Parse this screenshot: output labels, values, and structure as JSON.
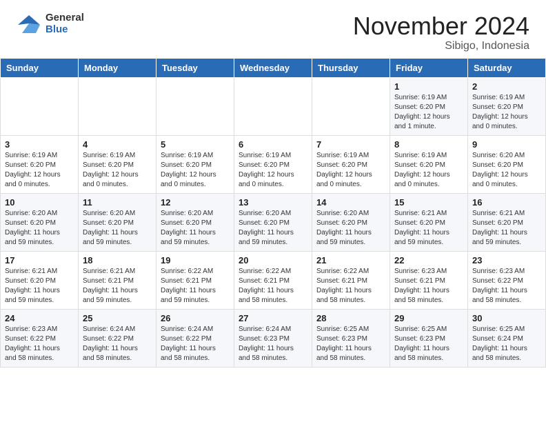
{
  "logo": {
    "general": "General",
    "blue": "Blue"
  },
  "title": {
    "month": "November 2024",
    "location": "Sibigo, Indonesia"
  },
  "weekdays": [
    "Sunday",
    "Monday",
    "Tuesday",
    "Wednesday",
    "Thursday",
    "Friday",
    "Saturday"
  ],
  "weeks": [
    [
      {
        "day": "",
        "info": ""
      },
      {
        "day": "",
        "info": ""
      },
      {
        "day": "",
        "info": ""
      },
      {
        "day": "",
        "info": ""
      },
      {
        "day": "",
        "info": ""
      },
      {
        "day": "1",
        "info": "Sunrise: 6:19 AM\nSunset: 6:20 PM\nDaylight: 12 hours\nand 1 minute."
      },
      {
        "day": "2",
        "info": "Sunrise: 6:19 AM\nSunset: 6:20 PM\nDaylight: 12 hours\nand 0 minutes."
      }
    ],
    [
      {
        "day": "3",
        "info": "Sunrise: 6:19 AM\nSunset: 6:20 PM\nDaylight: 12 hours\nand 0 minutes."
      },
      {
        "day": "4",
        "info": "Sunrise: 6:19 AM\nSunset: 6:20 PM\nDaylight: 12 hours\nand 0 minutes."
      },
      {
        "day": "5",
        "info": "Sunrise: 6:19 AM\nSunset: 6:20 PM\nDaylight: 12 hours\nand 0 minutes."
      },
      {
        "day": "6",
        "info": "Sunrise: 6:19 AM\nSunset: 6:20 PM\nDaylight: 12 hours\nand 0 minutes."
      },
      {
        "day": "7",
        "info": "Sunrise: 6:19 AM\nSunset: 6:20 PM\nDaylight: 12 hours\nand 0 minutes."
      },
      {
        "day": "8",
        "info": "Sunrise: 6:19 AM\nSunset: 6:20 PM\nDaylight: 12 hours\nand 0 minutes."
      },
      {
        "day": "9",
        "info": "Sunrise: 6:20 AM\nSunset: 6:20 PM\nDaylight: 12 hours\nand 0 minutes."
      }
    ],
    [
      {
        "day": "10",
        "info": "Sunrise: 6:20 AM\nSunset: 6:20 PM\nDaylight: 11 hours\nand 59 minutes."
      },
      {
        "day": "11",
        "info": "Sunrise: 6:20 AM\nSunset: 6:20 PM\nDaylight: 11 hours\nand 59 minutes."
      },
      {
        "day": "12",
        "info": "Sunrise: 6:20 AM\nSunset: 6:20 PM\nDaylight: 11 hours\nand 59 minutes."
      },
      {
        "day": "13",
        "info": "Sunrise: 6:20 AM\nSunset: 6:20 PM\nDaylight: 11 hours\nand 59 minutes."
      },
      {
        "day": "14",
        "info": "Sunrise: 6:20 AM\nSunset: 6:20 PM\nDaylight: 11 hours\nand 59 minutes."
      },
      {
        "day": "15",
        "info": "Sunrise: 6:21 AM\nSunset: 6:20 PM\nDaylight: 11 hours\nand 59 minutes."
      },
      {
        "day": "16",
        "info": "Sunrise: 6:21 AM\nSunset: 6:20 PM\nDaylight: 11 hours\nand 59 minutes."
      }
    ],
    [
      {
        "day": "17",
        "info": "Sunrise: 6:21 AM\nSunset: 6:20 PM\nDaylight: 11 hours\nand 59 minutes."
      },
      {
        "day": "18",
        "info": "Sunrise: 6:21 AM\nSunset: 6:21 PM\nDaylight: 11 hours\nand 59 minutes."
      },
      {
        "day": "19",
        "info": "Sunrise: 6:22 AM\nSunset: 6:21 PM\nDaylight: 11 hours\nand 59 minutes."
      },
      {
        "day": "20",
        "info": "Sunrise: 6:22 AM\nSunset: 6:21 PM\nDaylight: 11 hours\nand 58 minutes."
      },
      {
        "day": "21",
        "info": "Sunrise: 6:22 AM\nSunset: 6:21 PM\nDaylight: 11 hours\nand 58 minutes."
      },
      {
        "day": "22",
        "info": "Sunrise: 6:23 AM\nSunset: 6:21 PM\nDaylight: 11 hours\nand 58 minutes."
      },
      {
        "day": "23",
        "info": "Sunrise: 6:23 AM\nSunset: 6:22 PM\nDaylight: 11 hours\nand 58 minutes."
      }
    ],
    [
      {
        "day": "24",
        "info": "Sunrise: 6:23 AM\nSunset: 6:22 PM\nDaylight: 11 hours\nand 58 minutes."
      },
      {
        "day": "25",
        "info": "Sunrise: 6:24 AM\nSunset: 6:22 PM\nDaylight: 11 hours\nand 58 minutes."
      },
      {
        "day": "26",
        "info": "Sunrise: 6:24 AM\nSunset: 6:22 PM\nDaylight: 11 hours\nand 58 minutes."
      },
      {
        "day": "27",
        "info": "Sunrise: 6:24 AM\nSunset: 6:23 PM\nDaylight: 11 hours\nand 58 minutes."
      },
      {
        "day": "28",
        "info": "Sunrise: 6:25 AM\nSunset: 6:23 PM\nDaylight: 11 hours\nand 58 minutes."
      },
      {
        "day": "29",
        "info": "Sunrise: 6:25 AM\nSunset: 6:23 PM\nDaylight: 11 hours\nand 58 minutes."
      },
      {
        "day": "30",
        "info": "Sunrise: 6:25 AM\nSunset: 6:24 PM\nDaylight: 11 hours\nand 58 minutes."
      }
    ]
  ]
}
